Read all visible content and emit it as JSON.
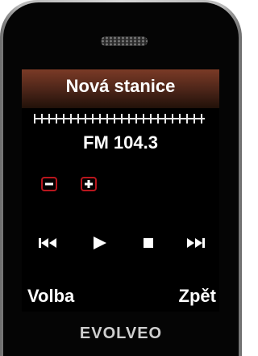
{
  "screen": {
    "title": "Nová stanice",
    "frequency": "FM 104.3"
  },
  "volume": {
    "decrease_icon": "minus-icon",
    "increase_icon": "plus-icon"
  },
  "controls": [
    {
      "name": "previous-station",
      "icon": "skip-back-icon"
    },
    {
      "name": "play",
      "icon": "play-icon"
    },
    {
      "name": "stop",
      "icon": "stop-icon"
    },
    {
      "name": "next-station",
      "icon": "skip-forward-icon"
    }
  ],
  "softkeys": {
    "left": "Volba",
    "right": "Zpět"
  },
  "brand": "EVOLVEO",
  "colors": {
    "accent_red": "#b8161d",
    "title_bar": "#5a2a1c",
    "text": "#ffffff"
  }
}
